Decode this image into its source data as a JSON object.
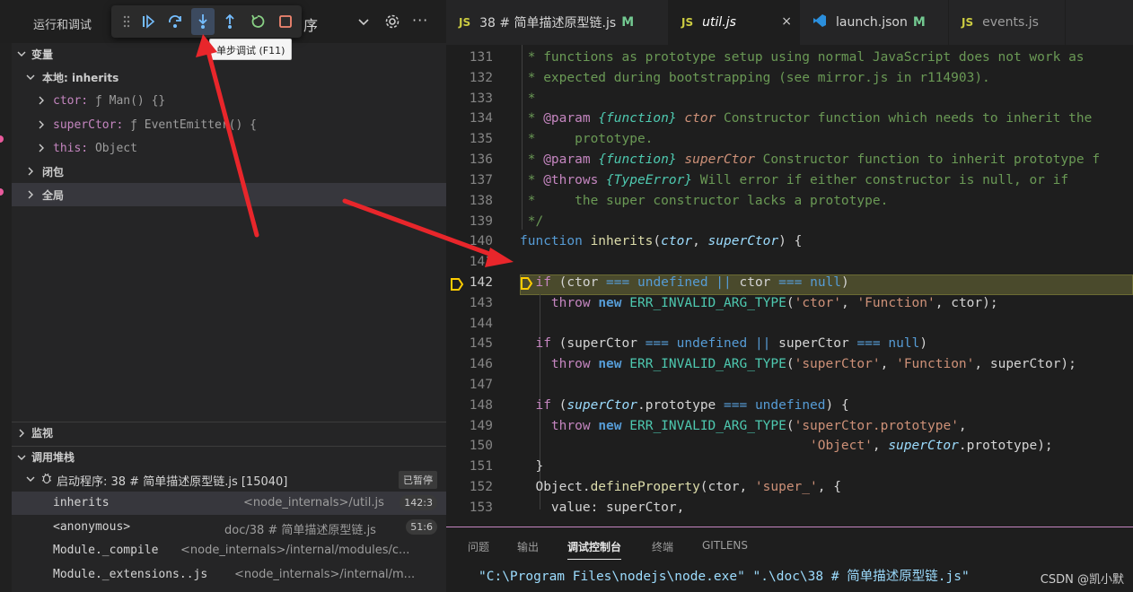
{
  "sidebar": {
    "title": "运行和调试",
    "config_name": "序",
    "sections": {
      "variables": "变量",
      "local": "本地: inherits",
      "closure": "闭包",
      "global": "全局",
      "watch": "监视",
      "callstack": "调用堆栈"
    },
    "locals": [
      {
        "key": "ctor:",
        "value": "ƒ Man() {}"
      },
      {
        "key": "superCtor:",
        "value": "ƒ EventEmitter() {"
      },
      {
        "key": "this:",
        "value": "Object"
      }
    ],
    "callstack": {
      "session": "启动程序: 38 # 简单描述原型链.js [15040]",
      "paused": "已暂停",
      "frames": [
        {
          "fn": "inherits",
          "src": "<node_internals>/util.js",
          "badge": "142:3"
        },
        {
          "fn": "<anonymous>",
          "src": "doc/38 # 简单描述原型链.js",
          "badge": "51:6"
        },
        {
          "fn": "Module._compile",
          "src": "<node_internals>/internal/modules/c...",
          "badge": ""
        },
        {
          "fn": "Module._extensions..js",
          "src": "<node_internals>/internal/m...",
          "badge": ""
        }
      ]
    }
  },
  "toolbar": {
    "buttons": [
      "drag-handle-icon",
      "continue-icon",
      "step-over-icon",
      "step-into-icon",
      "step-out-icon",
      "restart-icon",
      "stop-icon"
    ],
    "tooltip": "单步调试 (F11)"
  },
  "tabs": [
    {
      "label": "38 # 简单描述原型链.js",
      "mod": "M"
    },
    {
      "label": "util.js",
      "mod": "",
      "close": "×"
    },
    {
      "label": "launch.json",
      "mod": "M"
    },
    {
      "label": "events.js",
      "mod": ""
    }
  ],
  "tab_js_badge": "JS",
  "code": {
    "line_numbers": [
      "131",
      "132",
      "133",
      "134",
      "135",
      "136",
      "137",
      "138",
      "139",
      "140",
      "141",
      "142",
      "143",
      "144",
      "145",
      "146",
      "147",
      "148",
      "149",
      "150",
      "151",
      "152",
      "153"
    ],
    "current_line": "142"
  },
  "panel": {
    "tabs": [
      "问题",
      "输出",
      "调试控制台",
      "终端",
      "GITLENS"
    ],
    "active_tab": "调试控制台",
    "console_text": "\"C:\\Program Files\\nodejs\\node.exe\" \".\\doc\\38 # 简单描述原型链.js\"",
    "watermark": "CSDN @凯小默"
  },
  "colors": {
    "accent_arrow": "#e8262b",
    "debug_yellow": "#ffcc00",
    "modified": "#73c991"
  }
}
